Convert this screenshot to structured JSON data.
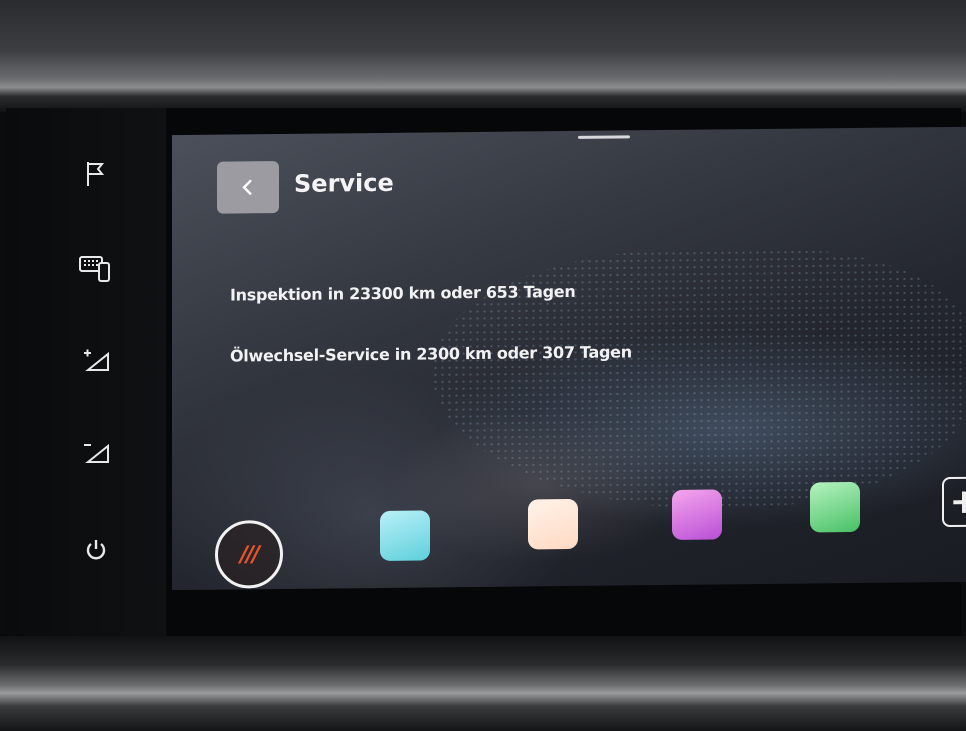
{
  "header": {
    "title": "Service"
  },
  "service": {
    "items": [
      "Inspektion in 23300 km oder 653 Tagen",
      "Ölwechsel-Service in 2300 km oder 307 Tagen"
    ]
  },
  "dock": {
    "menu_label": "///"
  },
  "side_buttons": [
    "flag-icon",
    "keyboard-phone-icon",
    "volume-up-icon",
    "volume-down-icon",
    "power-icon"
  ],
  "colors": {
    "accent": "#e8542c",
    "text": "#f1f2f4"
  }
}
